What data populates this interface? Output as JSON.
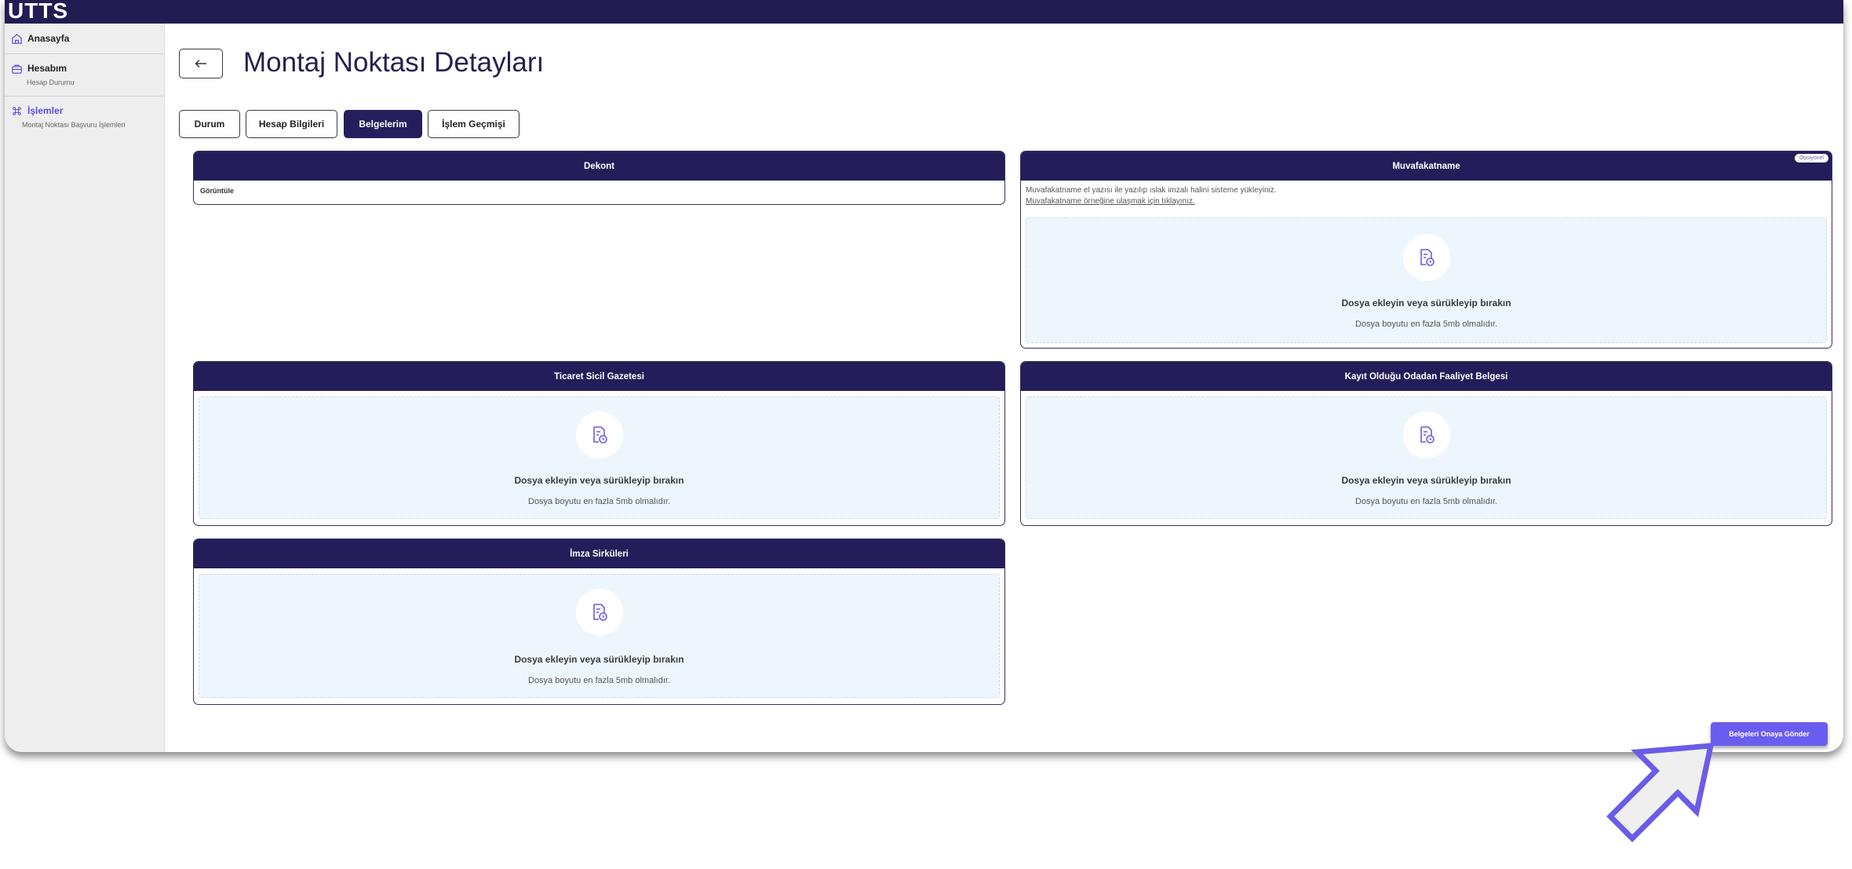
{
  "app": {
    "brand": "UTTS"
  },
  "colors": {
    "brand": "#211c52",
    "accent": "#6b5cf0",
    "dropzone_bg": "#eef6fd"
  },
  "sidebar": {
    "items": [
      {
        "label": "Anasayfa",
        "icon": "home-icon"
      },
      {
        "label": "Hesabım",
        "icon": "briefcase-icon",
        "sub": "Hesap Durumu"
      },
      {
        "label": "İşlemler",
        "icon": "command-icon",
        "sub": "Montaj Noktası Başvuru İşlemleri"
      }
    ]
  },
  "page": {
    "title": "Montaj Noktası Detayları",
    "back_icon": "arrow-left-icon"
  },
  "tabs": [
    {
      "label": "Durum"
    },
    {
      "label": "Hesap Bilgileri"
    },
    {
      "label": "Belgelerim"
    },
    {
      "label": "İşlem Geçmişi"
    }
  ],
  "cards": {
    "dekont": {
      "title": "Dekont",
      "view_label": "Görüntüle"
    },
    "muvafakatname": {
      "title": "Muvafakatname",
      "badge": "Opsiyonel",
      "description": "Muvafakatname el yazısı ile yazılıp ıslak imzalı halini sisteme yükleyiniz.",
      "sample_link": "Muvafakatname örneğine ulaşmak için tıklayınız."
    },
    "ticaret": {
      "title": "Ticaret Sicil Gazetesi"
    },
    "faaliyet": {
      "title": "Kayıt Olduğu Odadan Faaliyet Belgesi"
    },
    "imza": {
      "title": "İmza Sirküleri"
    }
  },
  "dropzone": {
    "title": "Dosya ekleyin veya sürükleyip bırakın",
    "hint": "Dosya boyutu en fazla 5mb olmalıdır.",
    "icon": "file-upload-icon"
  },
  "actions": {
    "submit_label": "Belgeleri Onaya Gönder"
  }
}
